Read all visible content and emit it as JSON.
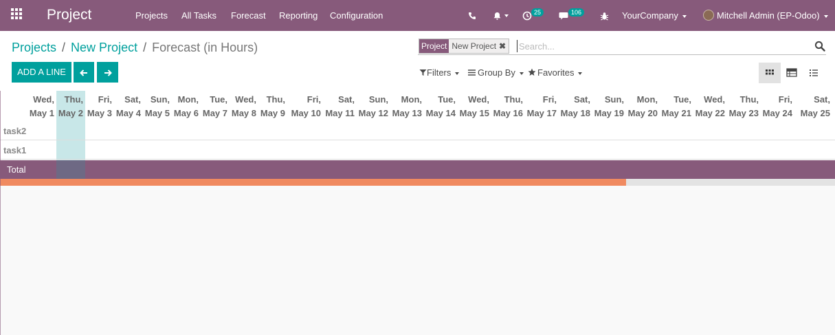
{
  "topbar": {
    "app_title": "Project",
    "menu": [
      "Projects",
      "All Tasks",
      "Forecast",
      "Reporting",
      "Configuration"
    ],
    "activity_count": "25",
    "message_count": "106",
    "company": "YourCompany",
    "user": "Mitchell Admin (EP-Odoo)"
  },
  "breadcrumb": {
    "root": "Projects",
    "parent": "New Project",
    "sep": "/",
    "current": "Forecast (in Hours)"
  },
  "search": {
    "facet_label": "Project",
    "facet_value": "New Project",
    "facet_remove": "✖",
    "placeholder": "Search..."
  },
  "buttons": {
    "add_line": "ADD A LINE"
  },
  "filters": {
    "filters_label": "Filters",
    "groupby_label": "Group By",
    "favorites_label": "Favorites"
  },
  "grid": {
    "days": [
      {
        "dow": "Wed,",
        "date": "May 1"
      },
      {
        "dow": "Thu,",
        "date": "May 2"
      },
      {
        "dow": "Fri,",
        "date": "May 3"
      },
      {
        "dow": "Sat,",
        "date": "May 4"
      },
      {
        "dow": "Sun,",
        "date": "May 5"
      },
      {
        "dow": "Mon,",
        "date": "May 6"
      },
      {
        "dow": "Tue,",
        "date": "May 7"
      },
      {
        "dow": "Wed,",
        "date": "May 8"
      },
      {
        "dow": "Thu,",
        "date": "May 9"
      },
      {
        "dow": "Fri,",
        "date": "May 10"
      },
      {
        "dow": "Sat,",
        "date": "May 11"
      },
      {
        "dow": "Sun,",
        "date": "May 12"
      },
      {
        "dow": "Mon,",
        "date": "May 13"
      },
      {
        "dow": "Tue,",
        "date": "May 14"
      },
      {
        "dow": "Wed,",
        "date": "May 15"
      },
      {
        "dow": "Thu,",
        "date": "May 16"
      },
      {
        "dow": "Fri,",
        "date": "May 17"
      },
      {
        "dow": "Sat,",
        "date": "May 18"
      },
      {
        "dow": "Sun,",
        "date": "May 19"
      },
      {
        "dow": "Mon,",
        "date": "May 20"
      },
      {
        "dow": "Tue,",
        "date": "May 21"
      },
      {
        "dow": "Wed,",
        "date": "May 22"
      },
      {
        "dow": "Thu,",
        "date": "May 23"
      },
      {
        "dow": "Fri,",
        "date": "May 24"
      },
      {
        "dow": "Sat,",
        "date": "May 25"
      }
    ],
    "rows": [
      "task2",
      "task1"
    ],
    "total_label": "Total",
    "progress_fraction": 0.75
  },
  "colors": {
    "brand": "#875a7b",
    "accent": "#00a09d",
    "progress": "#f08a60"
  }
}
